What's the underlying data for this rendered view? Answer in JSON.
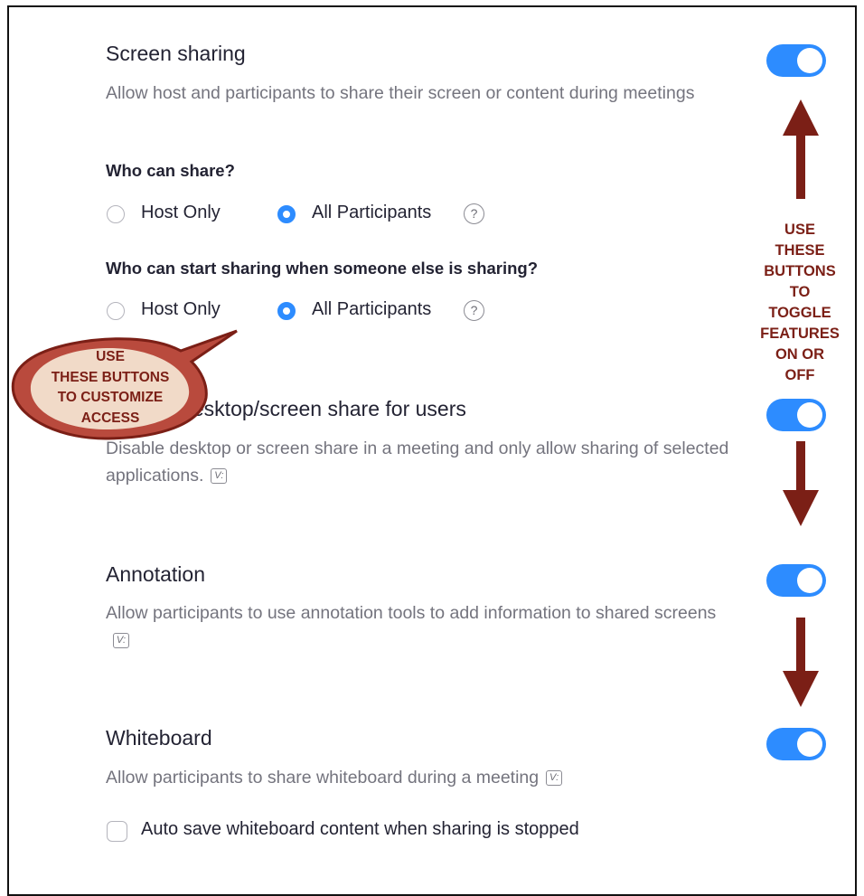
{
  "screen_sharing": {
    "title": "Screen sharing",
    "description": "Allow host and participants to share their screen or content during meetings",
    "toggle_on": true,
    "who_can_share": {
      "label": "Who can share?",
      "options": [
        "Host Only",
        "All Participants"
      ],
      "selected": "All Participants",
      "help": "?"
    },
    "who_can_start": {
      "label": "Who can start sharing when someone else is sharing?",
      "options": [
        "Host Only",
        "All Participants"
      ],
      "selected": "All Participants",
      "help": "?"
    }
  },
  "disable_desktop": {
    "title": "Disable desktop/screen share for users",
    "description": "Disable desktop or screen share in a meeting and only allow sharing of selected applications.",
    "badge": "V:",
    "toggle_on": true
  },
  "annotation": {
    "title": "Annotation",
    "description": "Allow participants to use annotation tools to add information to shared screens",
    "badge": "V:",
    "toggle_on": true
  },
  "whiteboard": {
    "title": "Whiteboard",
    "description": "Allow participants to share whiteboard during a meeting",
    "badge": "V:",
    "toggle_on": true,
    "autosave_label": "Auto save whiteboard content when sharing is stopped",
    "autosave_checked": false
  },
  "callouts": {
    "toggle_note": "USE THESE BUTTONS TO TOGGLE FEATURES ON OR OFF",
    "toggle_note_lines": [
      "USE",
      "THESE",
      "BUTTONS",
      "TO",
      "TOGGLE",
      "FEATURES",
      "ON OR",
      "OFF"
    ],
    "access_note": "USE THESE BUTTONS TO CUSTOMIZE ACCESS",
    "access_note_lines": [
      "USE",
      "THESE BUTTONS",
      "TO CUSTOMIZE",
      "ACCESS"
    ],
    "color": "#7b1f16"
  },
  "colors": {
    "accent": "#2d8cff",
    "title": "#232333",
    "muted": "#74747e"
  }
}
